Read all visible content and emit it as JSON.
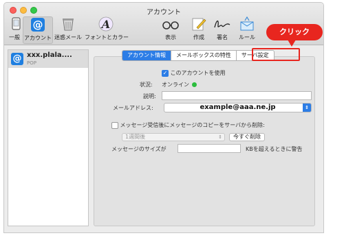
{
  "window": {
    "title": "アカウント"
  },
  "toolbar": {
    "items": [
      {
        "label": "一般",
        "icon": "phone-icon"
      },
      {
        "label": "アカウント",
        "icon": "at-icon",
        "active": true
      },
      {
        "label": "迷惑メール",
        "icon": "trash-icon"
      },
      {
        "label": "フォントとカラー",
        "icon": "font-icon"
      },
      {
        "label": "表示",
        "icon": "glasses-icon"
      },
      {
        "label": "作成",
        "icon": "compose-icon"
      },
      {
        "label": "署名",
        "icon": "signature-icon"
      },
      {
        "label": "ルール",
        "icon": "rules-icon"
      }
    ]
  },
  "sidebar": {
    "account": {
      "name": "xxx.plala....",
      "type": "POP"
    }
  },
  "tabs": [
    {
      "label": "アカウント情報",
      "active": true
    },
    {
      "label": "メールボックスの特性",
      "active": false
    },
    {
      "label": "サーバ設定",
      "active": false
    }
  ],
  "form": {
    "use_account_label": "このアカウントを使用",
    "use_account_checked": true,
    "status_label": "状況:",
    "status_value": "オンライン",
    "description_label": "説明:",
    "description_value": "",
    "email_label": "メールアドレス:",
    "email_value": "example@aaa.ne.jp",
    "remove_copy_label": "メッセージ受信後にメッセージのコピーをサーバから削除:",
    "remove_copy_checked": false,
    "remove_after_value": "1週間後",
    "remove_now_label": "今すぐ削除",
    "size_label": "メッセージのサイズが",
    "size_value": "",
    "size_suffix": "KBを超えるときに警告"
  },
  "annotation": {
    "callout_text": "クリック",
    "color": "#e8261f"
  }
}
